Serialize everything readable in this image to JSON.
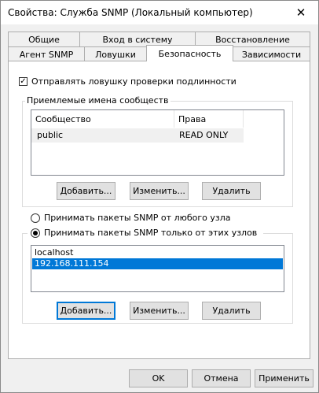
{
  "window": {
    "title": "Свойства: Служба SNMP (Локальный компьютер)",
    "close_glyph": "✕"
  },
  "tabs": {
    "row1": [
      "Общие",
      "Вход в систему",
      "Восстановление"
    ],
    "row2": [
      "Агент SNMP",
      "Ловушки",
      "Безопасность",
      "Зависимости"
    ],
    "active": "Безопасность"
  },
  "security": {
    "send_auth_trap": {
      "label": "Отправлять ловушку проверки подлинности",
      "checked": true
    },
    "communities": {
      "legend": "Приемлемые имена сообществ",
      "columns": [
        "Сообщество",
        "Права"
      ],
      "rows": [
        {
          "community": "public",
          "rights": "READ ONLY"
        }
      ],
      "buttons": {
        "add": "Добавить...",
        "edit": "Изменить...",
        "remove": "Удалить"
      }
    },
    "accept_any": {
      "label": "Принимать пакеты SNMP от любого узла",
      "selected": false
    },
    "accept_only": {
      "label": "Принимать пакеты SNMP только от этих узлов",
      "selected": true
    },
    "hosts": {
      "items": [
        "localhost",
        "192.168.111.154"
      ],
      "selected": "192.168.111.154",
      "buttons": {
        "add": "Добавить...",
        "edit": "Изменить...",
        "remove": "Удалить"
      }
    }
  },
  "footer": {
    "ok": "OK",
    "cancel": "Отмена",
    "apply": "Применить"
  }
}
